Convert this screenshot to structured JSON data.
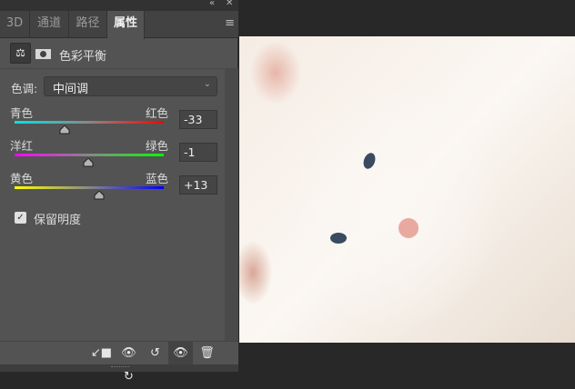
{
  "panel": {
    "tabs": [
      {
        "label": "3D"
      },
      {
        "label": "通道"
      },
      {
        "label": "路径"
      },
      {
        "label": "属性"
      }
    ],
    "active_tab": "属性",
    "title": "色彩平衡",
    "tone_label": "色调:",
    "tone_value": "中间调",
    "sliders": [
      {
        "left": "青色",
        "right": "红色",
        "value": "-33",
        "num": -33,
        "colors": [
          "#00e5e5",
          "#ff0000"
        ]
      },
      {
        "left": "洋红",
        "right": "绿色",
        "value": "-1",
        "num": -1,
        "colors": [
          "#ff00ff",
          "#00ff00"
        ]
      },
      {
        "left": "黄色",
        "right": "蓝色",
        "value": "+13",
        "num": 13,
        "colors": [
          "#ffff00",
          "#0000ff"
        ]
      }
    ],
    "slider_range": [
      -100,
      100
    ],
    "preserve_luminosity": {
      "label": "保留明度",
      "checked": true
    }
  }
}
